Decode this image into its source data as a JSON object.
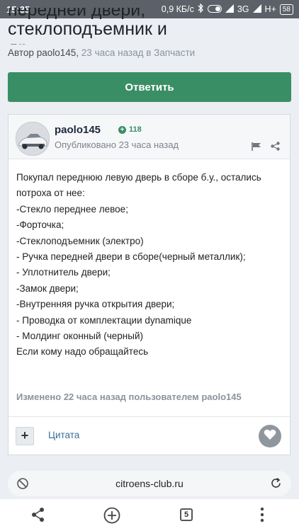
{
  "status_bar": {
    "time": "15:35",
    "network_speed": "0,9 КБ/с",
    "network_type": "3G",
    "carrier_indicator": "H+",
    "battery": "58"
  },
  "topic": {
    "title_partial_line1": "передней двери, стеклоподъемник и",
    "title_partial_line2": "др.",
    "author_prefix": "Автор",
    "author": "paolo145",
    "meta": "23 часа назад в Запчасти"
  },
  "reply_button": "Ответить",
  "post": {
    "username": "paolo145",
    "reputation": "118",
    "posted": "Опубликовано 23 часа назад",
    "body_lines": [
      "Покупал переднюю левую дверь в сборе б.у., остались",
      "потроха от нее:",
      "-Стекло переднее левое;",
      "-Форточка;",
      "-Стеклоподъемник (электро)",
      "- Ручка передней двери в сборе(черный металлик);",
      "- Уплотнитель двери;",
      "-Замок двери;",
      "-Внутренняя ручка открытия двери;",
      "- Проводка от комплектации dynamique",
      "- Молдинг оконный (черный)",
      "Если кому надо обращайтесь"
    ],
    "edited": "Изменено 22 часа назад пользователем paolo145",
    "add_label": "+",
    "quote_label": "Цитата"
  },
  "address_bar": {
    "url": "citroens-club.ru"
  },
  "browser_nav": {
    "tab_count": "5"
  },
  "colors": {
    "accent_green": "#3a8e66",
    "link_blue": "#3b6f9c",
    "status_bar": "#5c6169"
  }
}
